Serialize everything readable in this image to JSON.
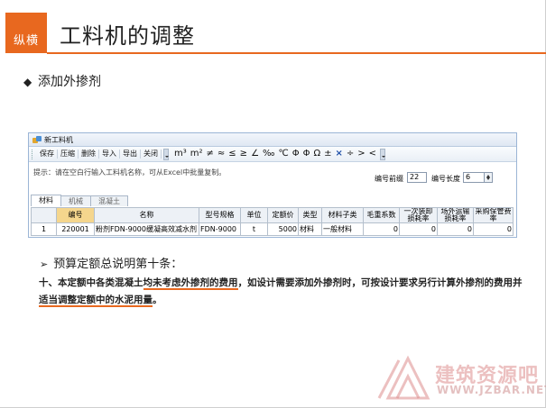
{
  "brand": {
    "label": "纵横",
    "accent": "#e8681f"
  },
  "slide": {
    "title": "工料机的调整",
    "bullet1": "添加外掺剂",
    "bullet1_icon": "diamond",
    "bullet2": "预算定额总说明第十条：",
    "bullet2_icon": "arrow-right"
  },
  "window": {
    "title": "新工料机",
    "toolbar_buttons": [
      "保存",
      "压缩",
      "删除",
      "导入",
      "导出",
      "关闭"
    ],
    "symbols": [
      "m³",
      "m²",
      "≠",
      "≈",
      "≤",
      "≥",
      "∠",
      "‰",
      "℃",
      "Φ",
      "Φ",
      "Ω",
      "±",
      "×",
      "÷",
      ">",
      "<"
    ],
    "hint": "提示：请在空白行输入工料机名称，可从Excel中批量复制。",
    "code_prefix_label": "编号前缀",
    "code_prefix_value": "22",
    "code_length_label": "编号长度",
    "code_length_value": "6",
    "tabs": [
      "材料",
      "机械",
      "混凝土"
    ],
    "active_tab": "材料",
    "columns": [
      "",
      "编号",
      "名称",
      "型号规格",
      "单位",
      "定额价",
      "类型",
      "材料子类",
      "毛重系数",
      "一次装卸损耗率",
      "场外运输损耗率",
      "采购保管费率"
    ],
    "rows": [
      {
        "index": "1",
        "code": "220001",
        "name": "粉剂FDN-9000缓凝高效减水剂",
        "spec": "FDN-9000",
        "unit": "t",
        "price": "5000",
        "type": "材料",
        "subclass": "一般材料",
        "gross": "0",
        "load_loss": "0",
        "transport_loss": "0",
        "storage_rate": "0"
      }
    ]
  },
  "paragraph": {
    "part1": "十、本定额中各类混凝土",
    "part2_underlined": "均未考虑外掺剂的费用",
    "part3": "，如设计需要添加外掺剂时，可按设计要求另行计算外掺剂的费用并",
    "part4_underlined": "适当调整定额中的水泥用量",
    "part5": "。"
  },
  "watermark": {
    "line1": "建筑资源吧",
    "line2": "WWW.JZBAR.NET"
  }
}
